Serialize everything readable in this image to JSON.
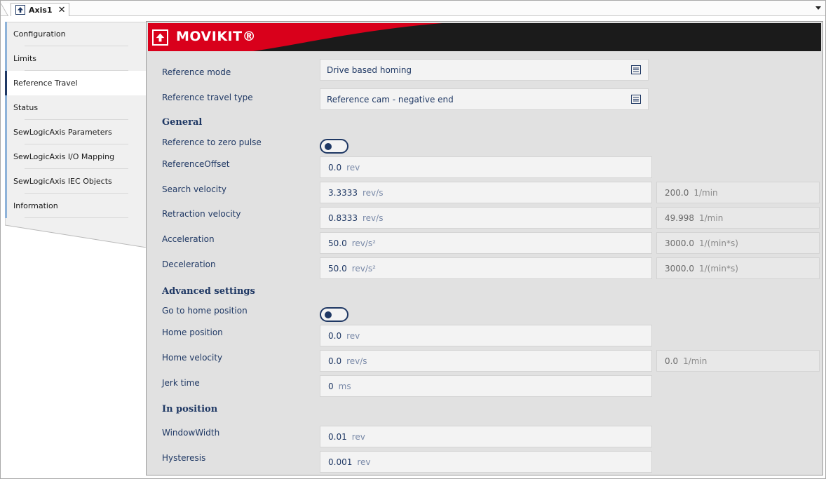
{
  "tab": {
    "label": "Axis1",
    "close": "✕"
  },
  "banner": {
    "title": "MOVIKIT®"
  },
  "nav": {
    "items": [
      {
        "label": "Configuration"
      },
      {
        "label": "Limits"
      },
      {
        "label": "Reference Travel"
      },
      {
        "label": "Status"
      },
      {
        "label": "SewLogicAxis Parameters"
      },
      {
        "label": "SewLogicAxis I/O Mapping"
      },
      {
        "label": "SewLogicAxis IEC Objects"
      },
      {
        "label": "Information"
      }
    ],
    "active_index": 2
  },
  "form": {
    "reference_mode": {
      "label": "Reference mode",
      "value": "Drive based homing"
    },
    "reference_travel_type": {
      "label": "Reference travel type",
      "value": "Reference cam - negative end"
    },
    "general": {
      "title": "General"
    },
    "reference_to_zero_pulse": {
      "label": "Reference to zero pulse",
      "on": false
    },
    "reference_offset": {
      "label": "ReferenceOffset",
      "value": "0.0",
      "unit": "rev"
    },
    "search_velocity": {
      "label": "Search velocity",
      "value": "3.3333",
      "unit": "rev/s",
      "conv_value": "200.0",
      "conv_unit": "1/min"
    },
    "retraction_velocity": {
      "label": "Retraction velocity",
      "value": "0.8333",
      "unit": "rev/s",
      "conv_value": "49.998",
      "conv_unit": "1/min"
    },
    "acceleration": {
      "label": "Acceleration",
      "value": "50.0",
      "unit": "rev/s²",
      "conv_value": "3000.0",
      "conv_unit": "1/(min*s)"
    },
    "deceleration": {
      "label": "Deceleration",
      "value": "50.0",
      "unit": "rev/s²",
      "conv_value": "3000.0",
      "conv_unit": "1/(min*s)"
    },
    "advanced": {
      "title": "Advanced settings"
    },
    "go_to_home_position": {
      "label": "Go to home position",
      "on": false
    },
    "home_position": {
      "label": "Home position",
      "value": "0.0",
      "unit": "rev"
    },
    "home_velocity": {
      "label": "Home velocity",
      "value": "0.0",
      "unit": "rev/s",
      "conv_value": "0.0",
      "conv_unit": "1/min"
    },
    "jerk_time": {
      "label": "Jerk time",
      "value": "0",
      "unit": "ms"
    },
    "in_position": {
      "title": "In position"
    },
    "window_width": {
      "label": "WindowWidth",
      "value": "0.01",
      "unit": "rev"
    },
    "hysteresis": {
      "label": "Hysteresis",
      "value": "0.001",
      "unit": "rev"
    }
  },
  "colors": {
    "accent": "#1f3864",
    "brand_red": "#d9001b",
    "banner_dark": "#1b1b1b",
    "panel_bg": "#e1e1e1",
    "nav_marker": "#8fb3d9"
  },
  "icons": {
    "tab": "arrow-up-box-icon",
    "banner": "arrow-up-box-icon",
    "select": "list-icon",
    "close": "close-icon",
    "dropdown": "chevron-down-icon"
  }
}
